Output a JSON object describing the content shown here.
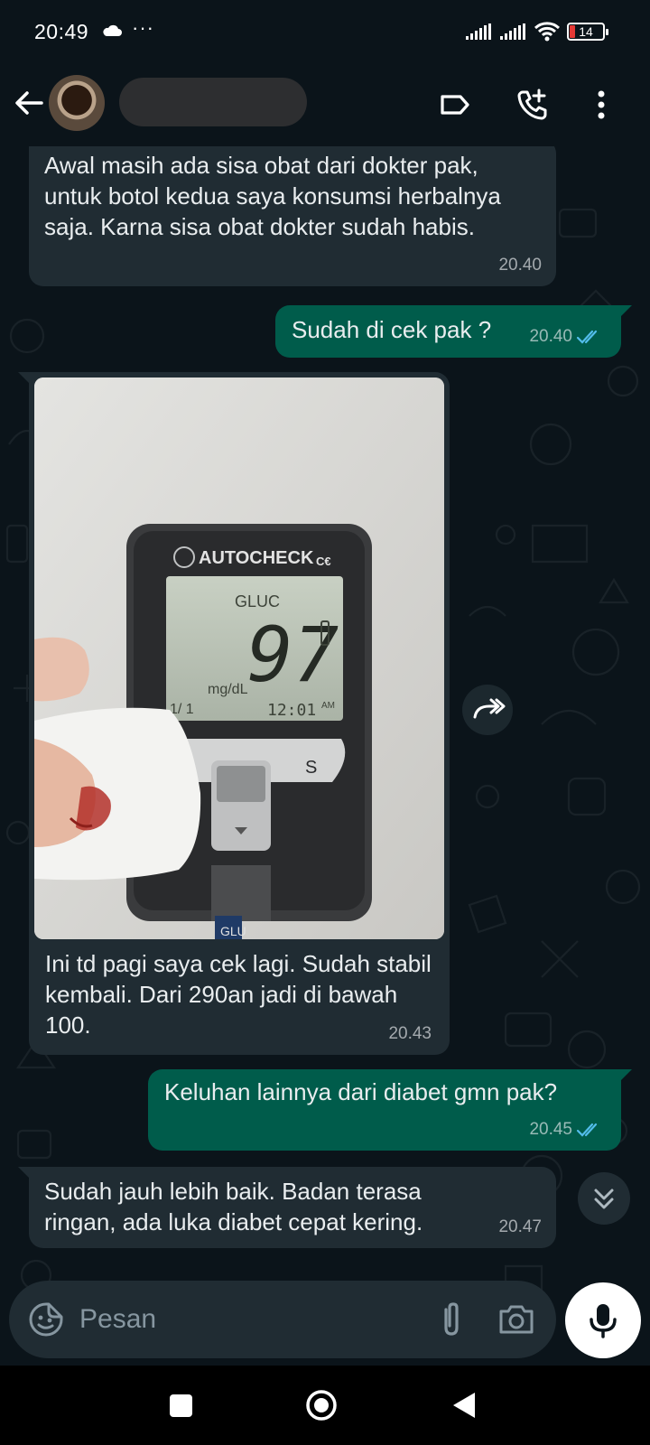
{
  "status_bar": {
    "time": "20:49",
    "dots": "···",
    "battery": "14"
  },
  "header": {
    "back_icon": "arrow-left-icon",
    "label_icon": "label-tag-icon",
    "call_icon": "add-call-icon",
    "menu_icon": "more-vert-icon"
  },
  "messages": [
    {
      "direction": "incoming",
      "text": "Awal masih ada sisa obat dari dokter pak, untuk botol kedua saya konsumsi herbalnya saja. Karna sisa obat dokter sudah habis.",
      "time": "20.40"
    },
    {
      "direction": "outgoing",
      "text": "Sudah di cek pak ?",
      "time": "20.40",
      "status": "read"
    },
    {
      "direction": "incoming",
      "type": "image",
      "image": {
        "brand": "AUTOCHECK",
        "brand_suffix": "C€",
        "label": "GLUC",
        "reading": "97",
        "unit": "mg/dL",
        "date": "1/ 1",
        "clock": "12:01",
        "ampm": "AM",
        "button": "S",
        "strip": "GLU"
      },
      "text": "Ini td pagi saya cek lagi. Sudah stabil kembali. Dari 290an jadi di bawah 100.",
      "time": "20.43"
    },
    {
      "direction": "outgoing",
      "text": "Keluhan lainnya dari diabet gmn pak?",
      "time": "20.45",
      "status": "read"
    },
    {
      "direction": "incoming",
      "text": "Sudah jauh lebih baik. Badan terasa ringan, ada luka diabet cepat kering.",
      "time": "20.47"
    }
  ],
  "composer": {
    "placeholder": "Pesan"
  },
  "colors": {
    "background": "#0b141a",
    "incoming_bubble": "#202c33",
    "outgoing_bubble": "#005c4b",
    "read_ticks": "#53bdeb"
  }
}
